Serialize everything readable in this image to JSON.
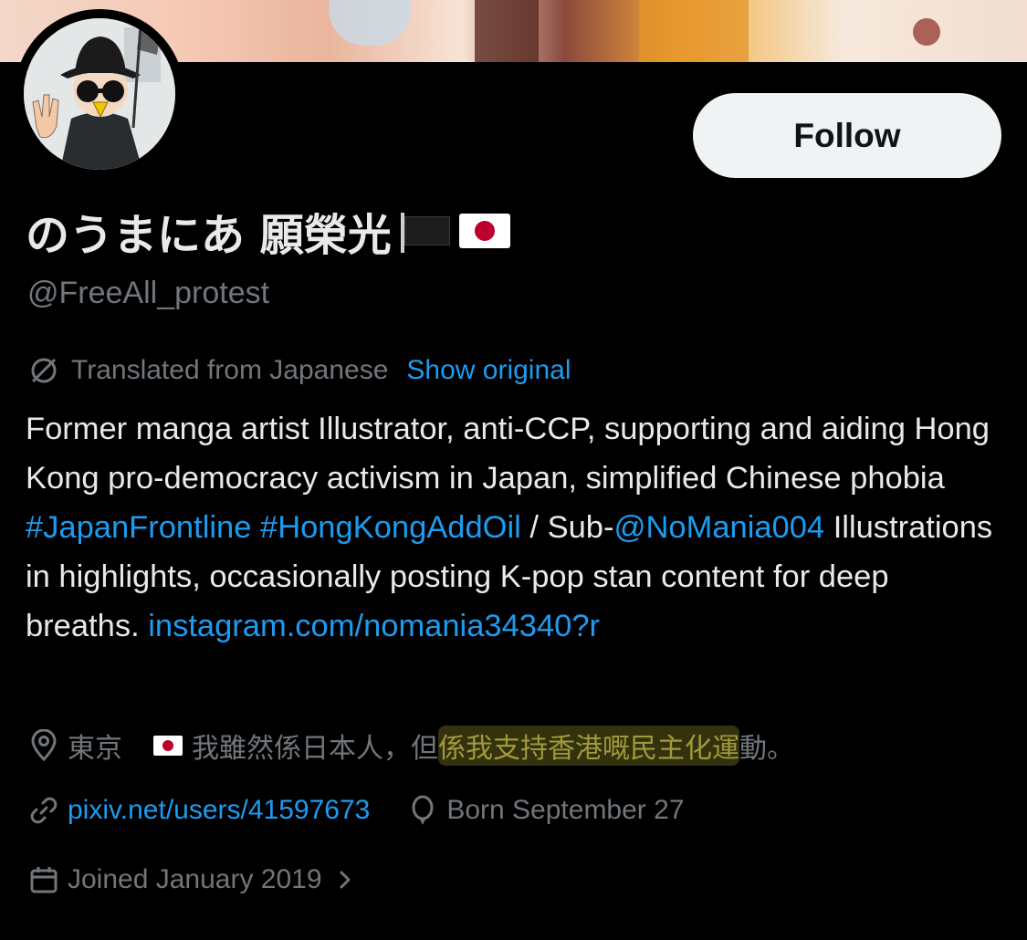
{
  "profile": {
    "display_name": "のうまにあ 願榮光",
    "handle": "@FreeAll_protest",
    "follow_label": "Follow",
    "translation": {
      "label": "Translated from Japanese",
      "show_original": "Show original"
    },
    "bio": {
      "part1": "Former manga artist Illustrator, anti-CCP, supporting and aiding Hong Kong pro-democracy activism in Japan, simplified Chinese phobia ",
      "hashtag1": "#JapanFrontline",
      "hashtag2": "#HongKongAddOil",
      "part2": " / Sub-",
      "mention": "@NoMania004",
      "part3": " Illustrations in highlights, occasionally posting K-pop stan content for deep breaths. ",
      "url": "instagram.com/nomania34340?r"
    },
    "location": "東京",
    "location_note_plain": "我雖然係日本人，但",
    "location_note_highlight": "係我支持香港嘅民主化運",
    "location_note_end": "動。",
    "website": "pixiv.net/users/41597673",
    "birthday": "Born September 27",
    "joined": "Joined January 2019"
  },
  "colors": {
    "background": "#000000",
    "text": "#e7e9ea",
    "muted": "#71767b",
    "link": "#1d9bf0",
    "follow_bg": "#eff3f4"
  },
  "icons": [
    "translate-icon",
    "location-icon",
    "link-icon",
    "balloon-icon",
    "calendar-icon",
    "chevron-right-icon",
    "black-flag-icon",
    "japan-flag-icon"
  ]
}
